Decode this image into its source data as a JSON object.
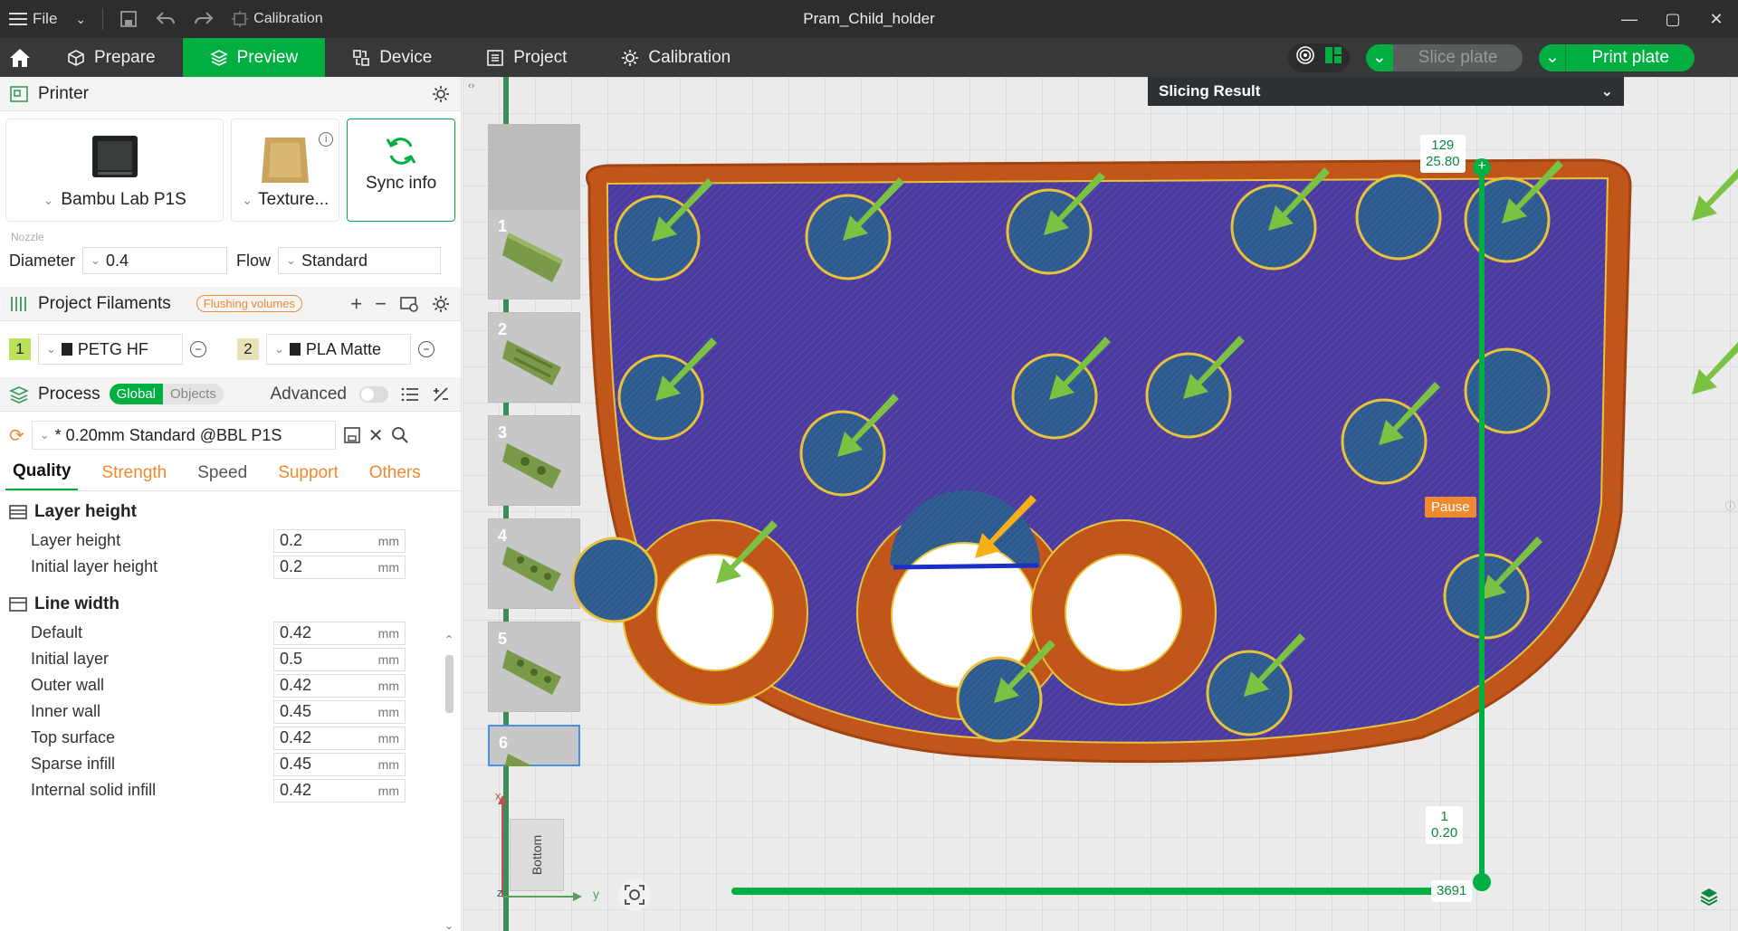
{
  "titlebar": {
    "file_label": "File",
    "calibration_label": "Calibration",
    "window_title": "Pram_Child_holder"
  },
  "tabs": [
    {
      "label": "Prepare"
    },
    {
      "label": "Preview"
    },
    {
      "label": "Device"
    },
    {
      "label": "Project"
    },
    {
      "label": "Calibration"
    }
  ],
  "actions": {
    "slice_label": "Slice plate",
    "print_label": "Print plate"
  },
  "printer": {
    "section_title": "Printer",
    "model": "Bambu Lab P1S",
    "plate": "Texture...",
    "sync_label": "Sync info",
    "nozzle_caption": "Nozzle",
    "diameter_label": "Diameter",
    "diameter_value": "0.4",
    "flow_label": "Flow",
    "flow_value": "Standard"
  },
  "filaments": {
    "section_title": "Project Filaments",
    "flushing_label": "Flushing volumes",
    "items": [
      {
        "index": "1",
        "name": "PETG HF",
        "color": "#b9e25a"
      },
      {
        "index": "2",
        "name": "PLA Matte",
        "color": "#e8e2b8"
      }
    ]
  },
  "process": {
    "section_title": "Process",
    "global_label": "Global",
    "objects_label": "Objects",
    "advanced_label": "Advanced",
    "preset": "* 0.20mm Standard @BBL P1S",
    "subtabs": [
      "Quality",
      "Strength",
      "Speed",
      "Support",
      "Others"
    ],
    "groups": [
      {
        "title": "Layer height",
        "rows": [
          {
            "label": "Layer height",
            "value": "0.2",
            "unit": "mm"
          },
          {
            "label": "Initial layer height",
            "value": "0.2",
            "unit": "mm"
          }
        ]
      },
      {
        "title": "Line width",
        "rows": [
          {
            "label": "Default",
            "value": "0.42",
            "unit": "mm"
          },
          {
            "label": "Initial layer",
            "value": "0.5",
            "unit": "mm"
          },
          {
            "label": "Outer wall",
            "value": "0.42",
            "unit": "mm"
          },
          {
            "label": "Inner wall",
            "value": "0.45",
            "unit": "mm"
          },
          {
            "label": "Top surface",
            "value": "0.42",
            "unit": "mm"
          },
          {
            "label": "Sparse infill",
            "value": "0.45",
            "unit": "mm"
          },
          {
            "label": "Internal solid infill",
            "value": "0.42",
            "unit": "mm"
          }
        ]
      }
    ]
  },
  "viewport": {
    "slicing_result_label": "Slicing Result",
    "plates": [
      "1",
      "2",
      "3",
      "4",
      "5",
      "6"
    ],
    "layer_top_number": "129",
    "layer_top_height": "25.80",
    "layer_bottom_number": "1",
    "layer_bottom_height": "0.20",
    "pause_label": "Pause",
    "move_value": "3691",
    "cube_label": "Bottom",
    "axis_x": "x",
    "axis_y": "y",
    "axis_z": "z"
  },
  "colors": {
    "accent": "#00ae42",
    "warning": "#f08a30",
    "model_blue": "#4a3aa0",
    "model_brown": "#c0561a",
    "arrow_green": "#7cc242",
    "arrow_yellow": "#f5b01a"
  }
}
